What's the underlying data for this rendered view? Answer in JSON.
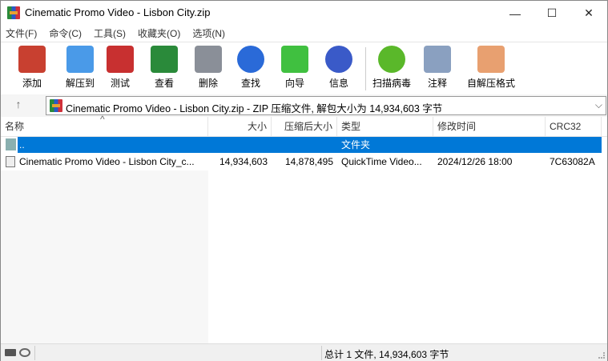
{
  "window": {
    "title": "Cinematic Promo Video - Lisbon City.zip",
    "minimize": "—",
    "maximize": "☐",
    "close": "✕"
  },
  "menu": [
    "文件(F)",
    "命令(C)",
    "工具(S)",
    "收藏夹(O)",
    "选项(N)"
  ],
  "toolbar": [
    {
      "label": "添加",
      "icon": "add-archive-icon",
      "color": "#c84030"
    },
    {
      "label": "解压到",
      "icon": "extract-folder-icon",
      "color": "#4a9ae8"
    },
    {
      "label": "测试",
      "icon": "test-clipboard-icon",
      "color": "#c83030"
    },
    {
      "label": "查看",
      "icon": "view-book-icon",
      "color": "#2a8a3a"
    },
    {
      "label": "删除",
      "icon": "delete-trash-icon",
      "color": "#8a8f98"
    },
    {
      "label": "查找",
      "icon": "find-magnifier-icon",
      "color": "#2a6ad8"
    },
    {
      "label": "向导",
      "icon": "wizard-wand-icon",
      "color": "#40c040"
    },
    {
      "label": "信息",
      "icon": "info-icon",
      "color": "#3a5ac8"
    },
    {
      "label": "扫描病毒",
      "icon": "virus-scan-icon",
      "color": "#5ab82a"
    },
    {
      "label": "注释",
      "icon": "comment-icon",
      "color": "#8aa0c0"
    },
    {
      "label": "自解压格式",
      "icon": "sfx-box-icon",
      "color": "#e8a070"
    }
  ],
  "address": {
    "up": "↑",
    "text": "Cinematic Promo Video - Lisbon City.zip - ZIP 压缩文件, 解包大小为 14,934,603 字节",
    "dropdown": "⌵"
  },
  "columns": {
    "name": "名称",
    "size": "大小",
    "packed": "压缩后大小",
    "type": "类型",
    "modified": "修改时间",
    "crc": "CRC32",
    "sort_indicator": "^"
  },
  "rows": [
    {
      "name": "..",
      "type": "文件夹"
    },
    {
      "name": "Cinematic Promo Video - Lisbon City_c...",
      "size": "14,934,603",
      "packed": "14,878,495",
      "type": "QuickTime Video...",
      "modified": "2024/12/26 18:00",
      "crc": "7C63082A"
    }
  ],
  "status": {
    "text": "总计 1 文件, 14,934,603 字节"
  }
}
